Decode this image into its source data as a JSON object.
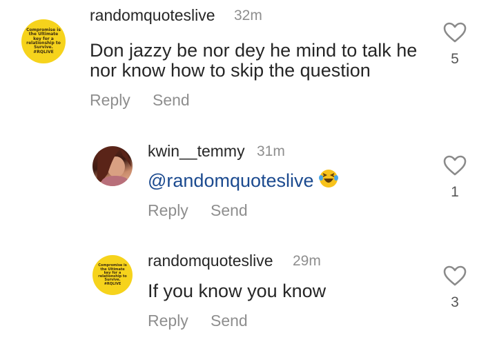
{
  "comments": [
    {
      "username": "randomquoteslive",
      "time": "32m",
      "text": "Don jazzy be nor dey he mind to talk he nor know how to skip the question",
      "line1": "Don jazzy be nor dey he mind to talk he",
      "line2": "nor know how to skip the question",
      "reply_label": "Reply",
      "send_label": "Send",
      "likes": "5",
      "avatar_text": "Compromise is the Ultimate key for a relationship to Survive. #RQLIVE"
    },
    {
      "username": "kwin__temmy",
      "time": "31m",
      "mention": "@randomquoteslive",
      "emoji": "laughing-with-tears-emoji",
      "reply_label": "Reply",
      "send_label": "Send",
      "likes": "1"
    },
    {
      "username": "randomquoteslive",
      "time": "29m",
      "text": "If you know you know",
      "reply_label": "Reply",
      "send_label": "Send",
      "likes": "3",
      "avatar_text": "Compromise is the Ultimate key for a relationship to Survive. #RQLIVE"
    }
  ],
  "icons": {
    "like": "heart-outline-icon"
  },
  "colors": {
    "avatar_yellow": "#f6d31c",
    "mention_blue": "#1b4a8f",
    "secondary_gray": "#8e8e8e"
  }
}
